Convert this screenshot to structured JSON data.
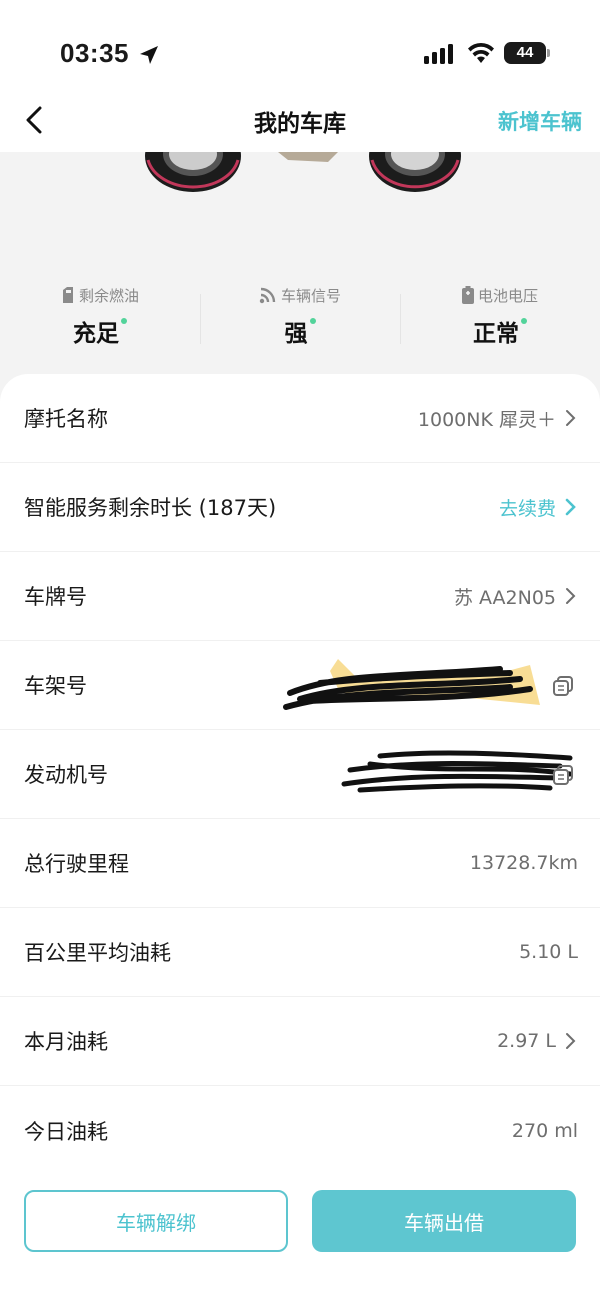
{
  "status_bar": {
    "time": "03:35",
    "battery": "44"
  },
  "nav": {
    "title": "我的车库",
    "add_vehicle": "新增车辆"
  },
  "stats": [
    {
      "label": "剩余燃油",
      "value": "充足",
      "icon": "fuel-icon"
    },
    {
      "label": "车辆信号",
      "value": "强",
      "icon": "signal-rss-icon"
    },
    {
      "label": "电池电压",
      "value": "正常",
      "icon": "battery-icon"
    }
  ],
  "rows": {
    "name": {
      "label": "摩托名称",
      "value": "1000NK 犀灵＋"
    },
    "service": {
      "label": "智能服务剩余时长 (187天)",
      "value": "去续费"
    },
    "plate": {
      "label": "车牌号",
      "value": "苏 AA2N05"
    },
    "frame": {
      "label": "车架号"
    },
    "engine": {
      "label": "发动机号"
    },
    "mileage": {
      "label": "总行驶里程",
      "value": "13728.7km"
    },
    "avg_fuel": {
      "label": "百公里平均油耗",
      "value": "5.10 L"
    },
    "month_fuel": {
      "label": "本月油耗",
      "value": "2.97 L"
    },
    "today_fuel": {
      "label": "今日油耗",
      "value": "270 ml"
    }
  },
  "buttons": {
    "unbind": "车辆解绑",
    "lend": "车辆出借"
  },
  "colors": {
    "accent": "#4cc3cf",
    "status_green": "#52d39a"
  }
}
